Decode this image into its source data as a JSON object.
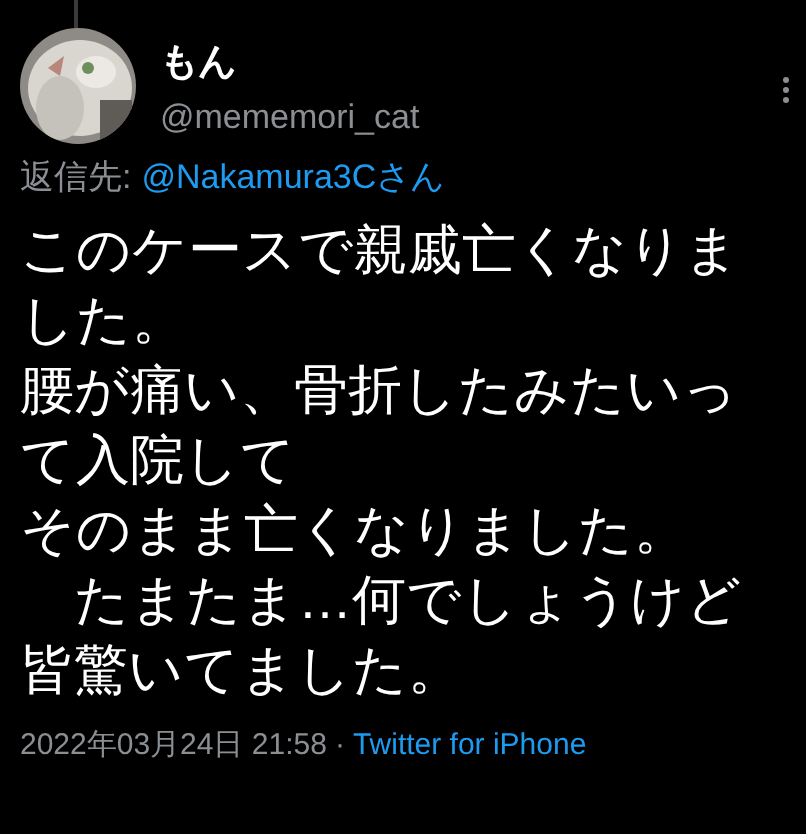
{
  "author": {
    "name": "もん",
    "handle": "@mememori_cat"
  },
  "reply_to": {
    "label": "返信先:",
    "mention": "@Nakamura3Cさん"
  },
  "body_lines": [
    "このケースで親戚亡くなりま",
    "した。",
    "腰が痛い、骨折したみたいっ",
    "て入院して",
    "そのまま亡くなりました。",
    "　たまたま…何でしょうけど",
    "皆驚いてました。"
  ],
  "timestamp": "2022年03月24日 21:58",
  "separator": "·",
  "source": "Twitter for iPhone"
}
